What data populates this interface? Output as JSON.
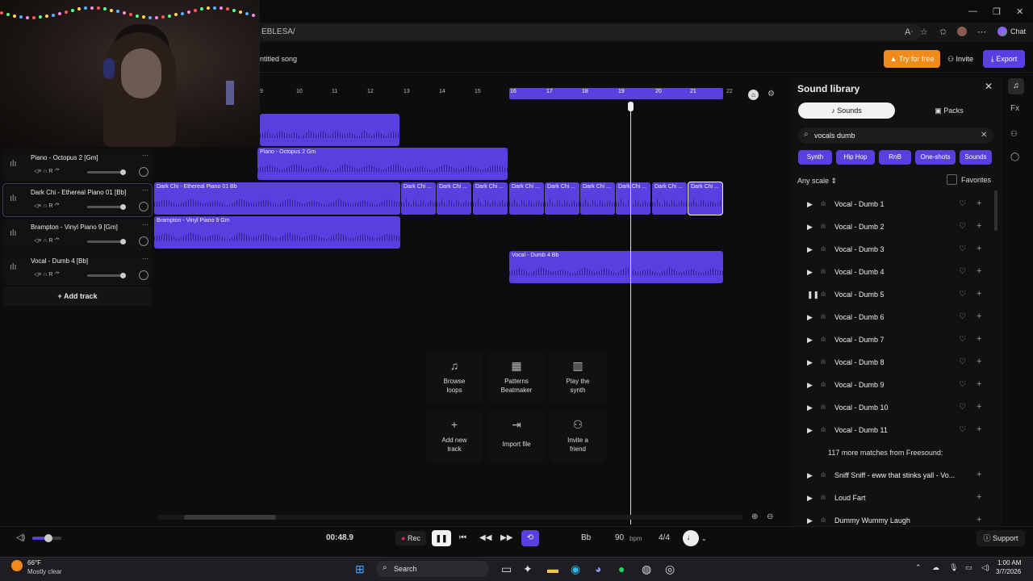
{
  "browser": {
    "address_fragment": "EBLESA/",
    "chat_label": "Chat"
  },
  "header": {
    "song_title": "ntitled song",
    "try_free": "Try for free",
    "invite": "Invite",
    "export": "Export"
  },
  "ruler": [
    "9",
    "10",
    "11",
    "12",
    "13",
    "14",
    "15",
    "16",
    "17",
    "18",
    "19",
    "20",
    "21",
    "22"
  ],
  "tracks": [
    {
      "name": "Piano - Octopus 2 [Gm]"
    },
    {
      "name": "Dark Chi - Ethereal Piano 01 [Bb]"
    },
    {
      "name": "Brampton - Vinyl Piano 9 [Gm]"
    },
    {
      "name": "Vocal - Dumb 4 [Bb]"
    }
  ],
  "track_controls": "R",
  "add_track": "Add track",
  "clips": {
    "piano": "Piano - Octopus 2 Gm",
    "darkchi_long": "Dark Chi - Ethereal Piano 01 Bb",
    "darkchi_short": "Dark Chi ...",
    "brampton": "Brampton - Vinyl Piano 9 Gm",
    "vocal": "Vocal - Dumb 4 Bb"
  },
  "quick_actions": [
    {
      "line1": "Browse",
      "line2": "loops",
      "icon": "music-note-icon"
    },
    {
      "line1": "Patterns",
      "line2": "Beatmaker",
      "icon": "grid-icon"
    },
    {
      "line1": "Play the",
      "line2": "synth",
      "icon": "piano-icon"
    },
    {
      "line1": "Add new",
      "line2": "track",
      "icon": "plus-icon"
    },
    {
      "line1": "Import file",
      "line2": "",
      "icon": "import-icon"
    },
    {
      "line1": "Invite a",
      "line2": "friend",
      "icon": "user-add-icon"
    }
  ],
  "transport": {
    "time": "00:48.9",
    "rec": "Rec",
    "key": "Bb",
    "bpm": "90",
    "bpm_unit": "bpm",
    "time_sig": "4/4",
    "support": "Support",
    "volume_level": 0.55
  },
  "library": {
    "title": "Sound library",
    "tab_sounds": "Sounds",
    "tab_packs": "Packs",
    "search_value": "vocals dumb",
    "chips": [
      "Synth",
      "Hip Hop",
      "RnB",
      "One-shots",
      "Sounds"
    ],
    "scale": "Any scale",
    "favorites": "Favorites",
    "results": [
      "Vocal - Dumb 1",
      "Vocal - Dumb 2",
      "Vocal - Dumb 3",
      "Vocal - Dumb 4",
      "Vocal - Dumb 5",
      "Vocal - Dumb 6",
      "Vocal - Dumb 7",
      "Vocal - Dumb 8",
      "Vocal - Dumb 9",
      "Vocal - Dumb 10",
      "Vocal - Dumb 11"
    ],
    "more_matches": "117 more matches from Freesound:",
    "freesound": [
      "Sniff Sniff - eww that stinks yall - Vo...",
      "Loud Fart",
      "Dummy Wummy Laugh"
    ]
  },
  "taskbar": {
    "weather_temp": "66°F",
    "weather_desc": "Mostly clear",
    "search": "Search",
    "time": "1:00 AM",
    "date": "3/7/2026"
  },
  "colors": {
    "accent": "#5a3fe0",
    "orange": "#f08a1a"
  }
}
